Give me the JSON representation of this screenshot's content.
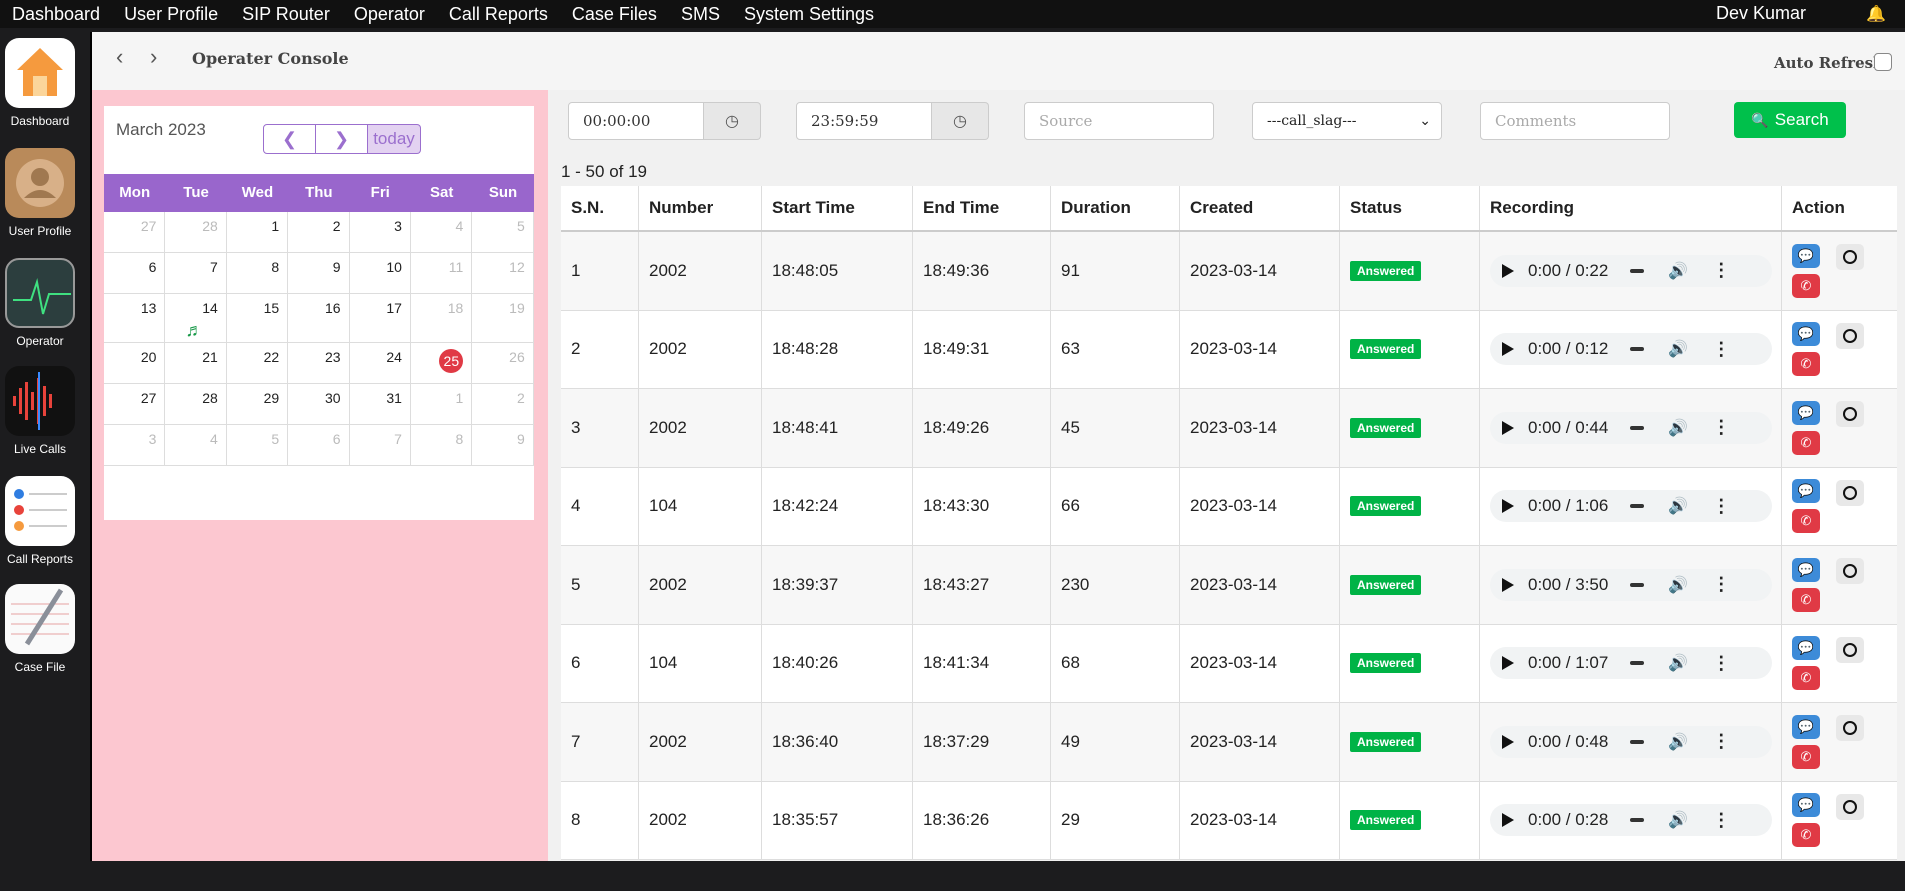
{
  "nav": {
    "items": [
      "Dashboard",
      "User Profile",
      "SIP Router",
      "Operator",
      "Call Reports",
      "Case Files",
      "SMS",
      "System Settings"
    ],
    "user": "Dev Kumar"
  },
  "dock": [
    {
      "label": "Dashboard",
      "icon": "home-icon"
    },
    {
      "label": "User Profile",
      "icon": "contacts-icon"
    },
    {
      "label": "Operator",
      "icon": "activity-monitor-icon"
    },
    {
      "label": "Live Calls",
      "icon": "voice-waveform-icon"
    },
    {
      "label": "Call Reports",
      "icon": "reminders-list-icon"
    },
    {
      "label": "Case File",
      "icon": "notepad-pencil-icon"
    }
  ],
  "header": {
    "title": "Operater Console",
    "auto_refresh": "Auto Refresh"
  },
  "calendar": {
    "month": "March 2023",
    "prev": "❮",
    "next": "❯",
    "today": "today",
    "days": [
      "Mon",
      "Tue",
      "Wed",
      "Thu",
      "Fri",
      "Sat",
      "Sun"
    ],
    "weeks": [
      [
        "27",
        "28",
        "1",
        "2",
        "3",
        "4",
        "5"
      ],
      [
        "6",
        "7",
        "8",
        "9",
        "10",
        "11",
        "12"
      ],
      [
        "13",
        "14",
        "15",
        "16",
        "17",
        "18",
        "19"
      ],
      [
        "20",
        "21",
        "22",
        "23",
        "24",
        "25",
        "26"
      ],
      [
        "27",
        "28",
        "29",
        "30",
        "31",
        "1",
        "2"
      ],
      [
        "3",
        "4",
        "5",
        "6",
        "7",
        "8",
        "9"
      ]
    ],
    "today_date": "25"
  },
  "filters": {
    "start_time": "00:00:00",
    "end_time": "23:59:59",
    "source_placeholder": "Source",
    "call_slag": "---call_slag---",
    "comments_placeholder": "Comments",
    "search_label": "Search"
  },
  "count_text": "1 - 50 of 19",
  "table": {
    "headers": [
      "S.N.",
      "Number",
      "Start Time",
      "End Time",
      "Duration",
      "Created",
      "Status",
      "Recording",
      "Action"
    ],
    "rows": [
      [
        "1",
        "2002",
        "18:48:05",
        "18:49:36",
        "91",
        "2023-03-14",
        "Answered",
        "0:00 / 0:22"
      ],
      [
        "2",
        "2002",
        "18:48:28",
        "18:49:31",
        "63",
        "2023-03-14",
        "Answered",
        "0:00 / 0:12"
      ],
      [
        "3",
        "2002",
        "18:48:41",
        "18:49:26",
        "45",
        "2023-03-14",
        "Answered",
        "0:00 / 0:44"
      ],
      [
        "4",
        "104",
        "18:42:24",
        "18:43:30",
        "66",
        "2023-03-14",
        "Answered",
        "0:00 / 1:06"
      ],
      [
        "5",
        "2002",
        "18:39:37",
        "18:43:27",
        "230",
        "2023-03-14",
        "Answered",
        "0:00 / 3:50"
      ],
      [
        "6",
        "104",
        "18:40:26",
        "18:41:34",
        "68",
        "2023-03-14",
        "Answered",
        "0:00 / 1:07"
      ],
      [
        "7",
        "2002",
        "18:36:40",
        "18:37:29",
        "49",
        "2023-03-14",
        "Answered",
        "0:00 / 0:48"
      ],
      [
        "8",
        "2002",
        "18:35:57",
        "18:36:26",
        "29",
        "2023-03-14",
        "Answered",
        "0:00 / 0:28"
      ]
    ]
  },
  "colors": {
    "accent": "#9966cc",
    "success": "#00b346",
    "danger": "#e03a45",
    "info": "#3d8bd8",
    "calendar_bg": "#fcc7d0"
  }
}
